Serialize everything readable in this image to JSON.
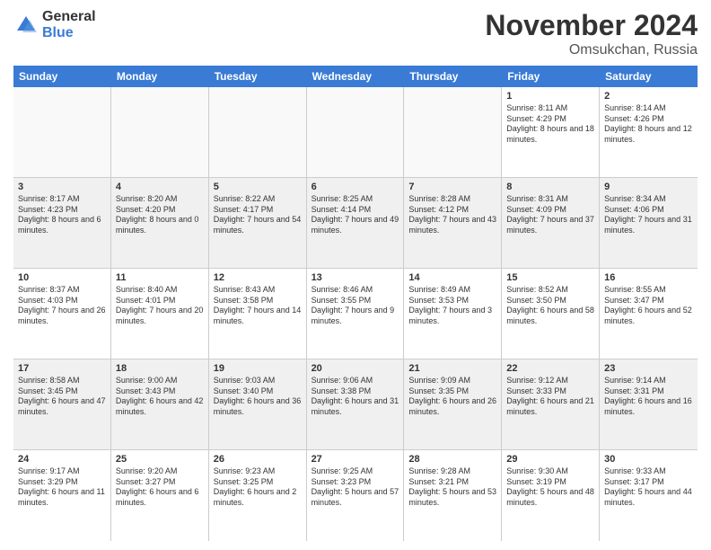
{
  "logo": {
    "general": "General",
    "blue": "Blue"
  },
  "title": "November 2024",
  "location": "Omsukchan, Russia",
  "weekdays": [
    "Sunday",
    "Monday",
    "Tuesday",
    "Wednesday",
    "Thursday",
    "Friday",
    "Saturday"
  ],
  "rows": [
    [
      {
        "day": "",
        "text": "",
        "empty": true
      },
      {
        "day": "",
        "text": "",
        "empty": true
      },
      {
        "day": "",
        "text": "",
        "empty": true
      },
      {
        "day": "",
        "text": "",
        "empty": true
      },
      {
        "day": "",
        "text": "",
        "empty": true
      },
      {
        "day": "1",
        "text": "Sunrise: 8:11 AM\nSunset: 4:29 PM\nDaylight: 8 hours and 18 minutes.",
        "empty": false
      },
      {
        "day": "2",
        "text": "Sunrise: 8:14 AM\nSunset: 4:26 PM\nDaylight: 8 hours and 12 minutes.",
        "empty": false
      }
    ],
    [
      {
        "day": "3",
        "text": "Sunrise: 8:17 AM\nSunset: 4:23 PM\nDaylight: 8 hours and 6 minutes.",
        "empty": false
      },
      {
        "day": "4",
        "text": "Sunrise: 8:20 AM\nSunset: 4:20 PM\nDaylight: 8 hours and 0 minutes.",
        "empty": false
      },
      {
        "day": "5",
        "text": "Sunrise: 8:22 AM\nSunset: 4:17 PM\nDaylight: 7 hours and 54 minutes.",
        "empty": false
      },
      {
        "day": "6",
        "text": "Sunrise: 8:25 AM\nSunset: 4:14 PM\nDaylight: 7 hours and 49 minutes.",
        "empty": false
      },
      {
        "day": "7",
        "text": "Sunrise: 8:28 AM\nSunset: 4:12 PM\nDaylight: 7 hours and 43 minutes.",
        "empty": false
      },
      {
        "day": "8",
        "text": "Sunrise: 8:31 AM\nSunset: 4:09 PM\nDaylight: 7 hours and 37 minutes.",
        "empty": false
      },
      {
        "day": "9",
        "text": "Sunrise: 8:34 AM\nSunset: 4:06 PM\nDaylight: 7 hours and 31 minutes.",
        "empty": false
      }
    ],
    [
      {
        "day": "10",
        "text": "Sunrise: 8:37 AM\nSunset: 4:03 PM\nDaylight: 7 hours and 26 minutes.",
        "empty": false
      },
      {
        "day": "11",
        "text": "Sunrise: 8:40 AM\nSunset: 4:01 PM\nDaylight: 7 hours and 20 minutes.",
        "empty": false
      },
      {
        "day": "12",
        "text": "Sunrise: 8:43 AM\nSunset: 3:58 PM\nDaylight: 7 hours and 14 minutes.",
        "empty": false
      },
      {
        "day": "13",
        "text": "Sunrise: 8:46 AM\nSunset: 3:55 PM\nDaylight: 7 hours and 9 minutes.",
        "empty": false
      },
      {
        "day": "14",
        "text": "Sunrise: 8:49 AM\nSunset: 3:53 PM\nDaylight: 7 hours and 3 minutes.",
        "empty": false
      },
      {
        "day": "15",
        "text": "Sunrise: 8:52 AM\nSunset: 3:50 PM\nDaylight: 6 hours and 58 minutes.",
        "empty": false
      },
      {
        "day": "16",
        "text": "Sunrise: 8:55 AM\nSunset: 3:47 PM\nDaylight: 6 hours and 52 minutes.",
        "empty": false
      }
    ],
    [
      {
        "day": "17",
        "text": "Sunrise: 8:58 AM\nSunset: 3:45 PM\nDaylight: 6 hours and 47 minutes.",
        "empty": false
      },
      {
        "day": "18",
        "text": "Sunrise: 9:00 AM\nSunset: 3:43 PM\nDaylight: 6 hours and 42 minutes.",
        "empty": false
      },
      {
        "day": "19",
        "text": "Sunrise: 9:03 AM\nSunset: 3:40 PM\nDaylight: 6 hours and 36 minutes.",
        "empty": false
      },
      {
        "day": "20",
        "text": "Sunrise: 9:06 AM\nSunset: 3:38 PM\nDaylight: 6 hours and 31 minutes.",
        "empty": false
      },
      {
        "day": "21",
        "text": "Sunrise: 9:09 AM\nSunset: 3:35 PM\nDaylight: 6 hours and 26 minutes.",
        "empty": false
      },
      {
        "day": "22",
        "text": "Sunrise: 9:12 AM\nSunset: 3:33 PM\nDaylight: 6 hours and 21 minutes.",
        "empty": false
      },
      {
        "day": "23",
        "text": "Sunrise: 9:14 AM\nSunset: 3:31 PM\nDaylight: 6 hours and 16 minutes.",
        "empty": false
      }
    ],
    [
      {
        "day": "24",
        "text": "Sunrise: 9:17 AM\nSunset: 3:29 PM\nDaylight: 6 hours and 11 minutes.",
        "empty": false
      },
      {
        "day": "25",
        "text": "Sunrise: 9:20 AM\nSunset: 3:27 PM\nDaylight: 6 hours and 6 minutes.",
        "empty": false
      },
      {
        "day": "26",
        "text": "Sunrise: 9:23 AM\nSunset: 3:25 PM\nDaylight: 6 hours and 2 minutes.",
        "empty": false
      },
      {
        "day": "27",
        "text": "Sunrise: 9:25 AM\nSunset: 3:23 PM\nDaylight: 5 hours and 57 minutes.",
        "empty": false
      },
      {
        "day": "28",
        "text": "Sunrise: 9:28 AM\nSunset: 3:21 PM\nDaylight: 5 hours and 53 minutes.",
        "empty": false
      },
      {
        "day": "29",
        "text": "Sunrise: 9:30 AM\nSunset: 3:19 PM\nDaylight: 5 hours and 48 minutes.",
        "empty": false
      },
      {
        "day": "30",
        "text": "Sunrise: 9:33 AM\nSunset: 3:17 PM\nDaylight: 5 hours and 44 minutes.",
        "empty": false
      }
    ]
  ]
}
